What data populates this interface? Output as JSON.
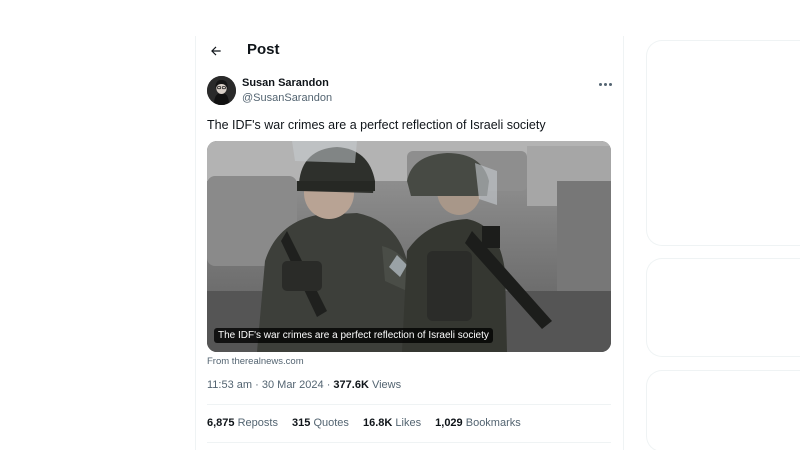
{
  "header": {
    "title": "Post",
    "back_icon": "arrow-left-icon"
  },
  "tweet": {
    "author_name": "Susan Sarandon",
    "author_handle": "@SusanSarandon",
    "more_icon": "more-horizontal-icon",
    "text": "The IDF's war crimes are a perfect reflection of Israeli society",
    "card": {
      "caption": "The IDF's war crimes are a perfect reflection of Israeli society",
      "source": "From therealnews.com"
    },
    "meta": {
      "time": "11:53 am",
      "separator": "·",
      "date": "30 Mar 2024",
      "views_count": "377.6K",
      "views_label": "Views"
    },
    "stats": {
      "reposts_count": "6,875",
      "reposts_label": "Reposts",
      "quotes_count": "315",
      "quotes_label": "Quotes",
      "likes_count": "16.8K",
      "likes_label": "Likes",
      "bookmarks_count": "1,029",
      "bookmarks_label": "Bookmarks"
    }
  },
  "colors": {
    "text_primary": "#0f1419",
    "text_secondary": "#536471",
    "border": "#eff3f4"
  }
}
